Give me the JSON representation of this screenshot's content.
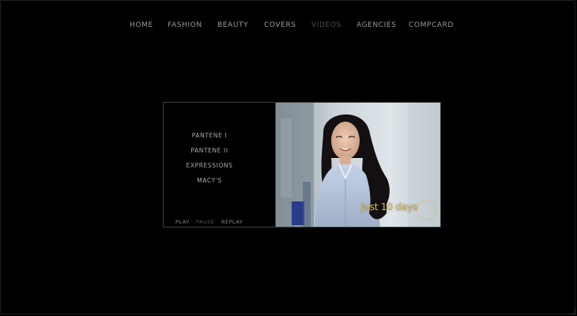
{
  "nav": {
    "items": [
      {
        "label": "HOME",
        "active": false
      },
      {
        "label": "FASHION",
        "active": false
      },
      {
        "label": "BEAUTY",
        "active": false
      },
      {
        "label": "COVERS",
        "active": false
      },
      {
        "label": "VIDEOS",
        "active": true
      },
      {
        "label": "AGENCIES",
        "active": false
      },
      {
        "label": "COMPCARD",
        "active": false
      }
    ]
  },
  "player": {
    "videos": [
      {
        "label": "PANTENE I"
      },
      {
        "label": "PANTENE II"
      },
      {
        "label": "EXPRESSIONS"
      },
      {
        "label": "MACY'S"
      }
    ],
    "controls": {
      "play": "PLAY",
      "pause": "PAUSE",
      "replay": "REPLAY"
    },
    "overlay_text": "Just 10 days"
  },
  "colors": {
    "background": "#000000",
    "nav_text": "#9a9a9a",
    "nav_active": "#4e4e4e",
    "overlay_gold": "#d8b75a"
  }
}
